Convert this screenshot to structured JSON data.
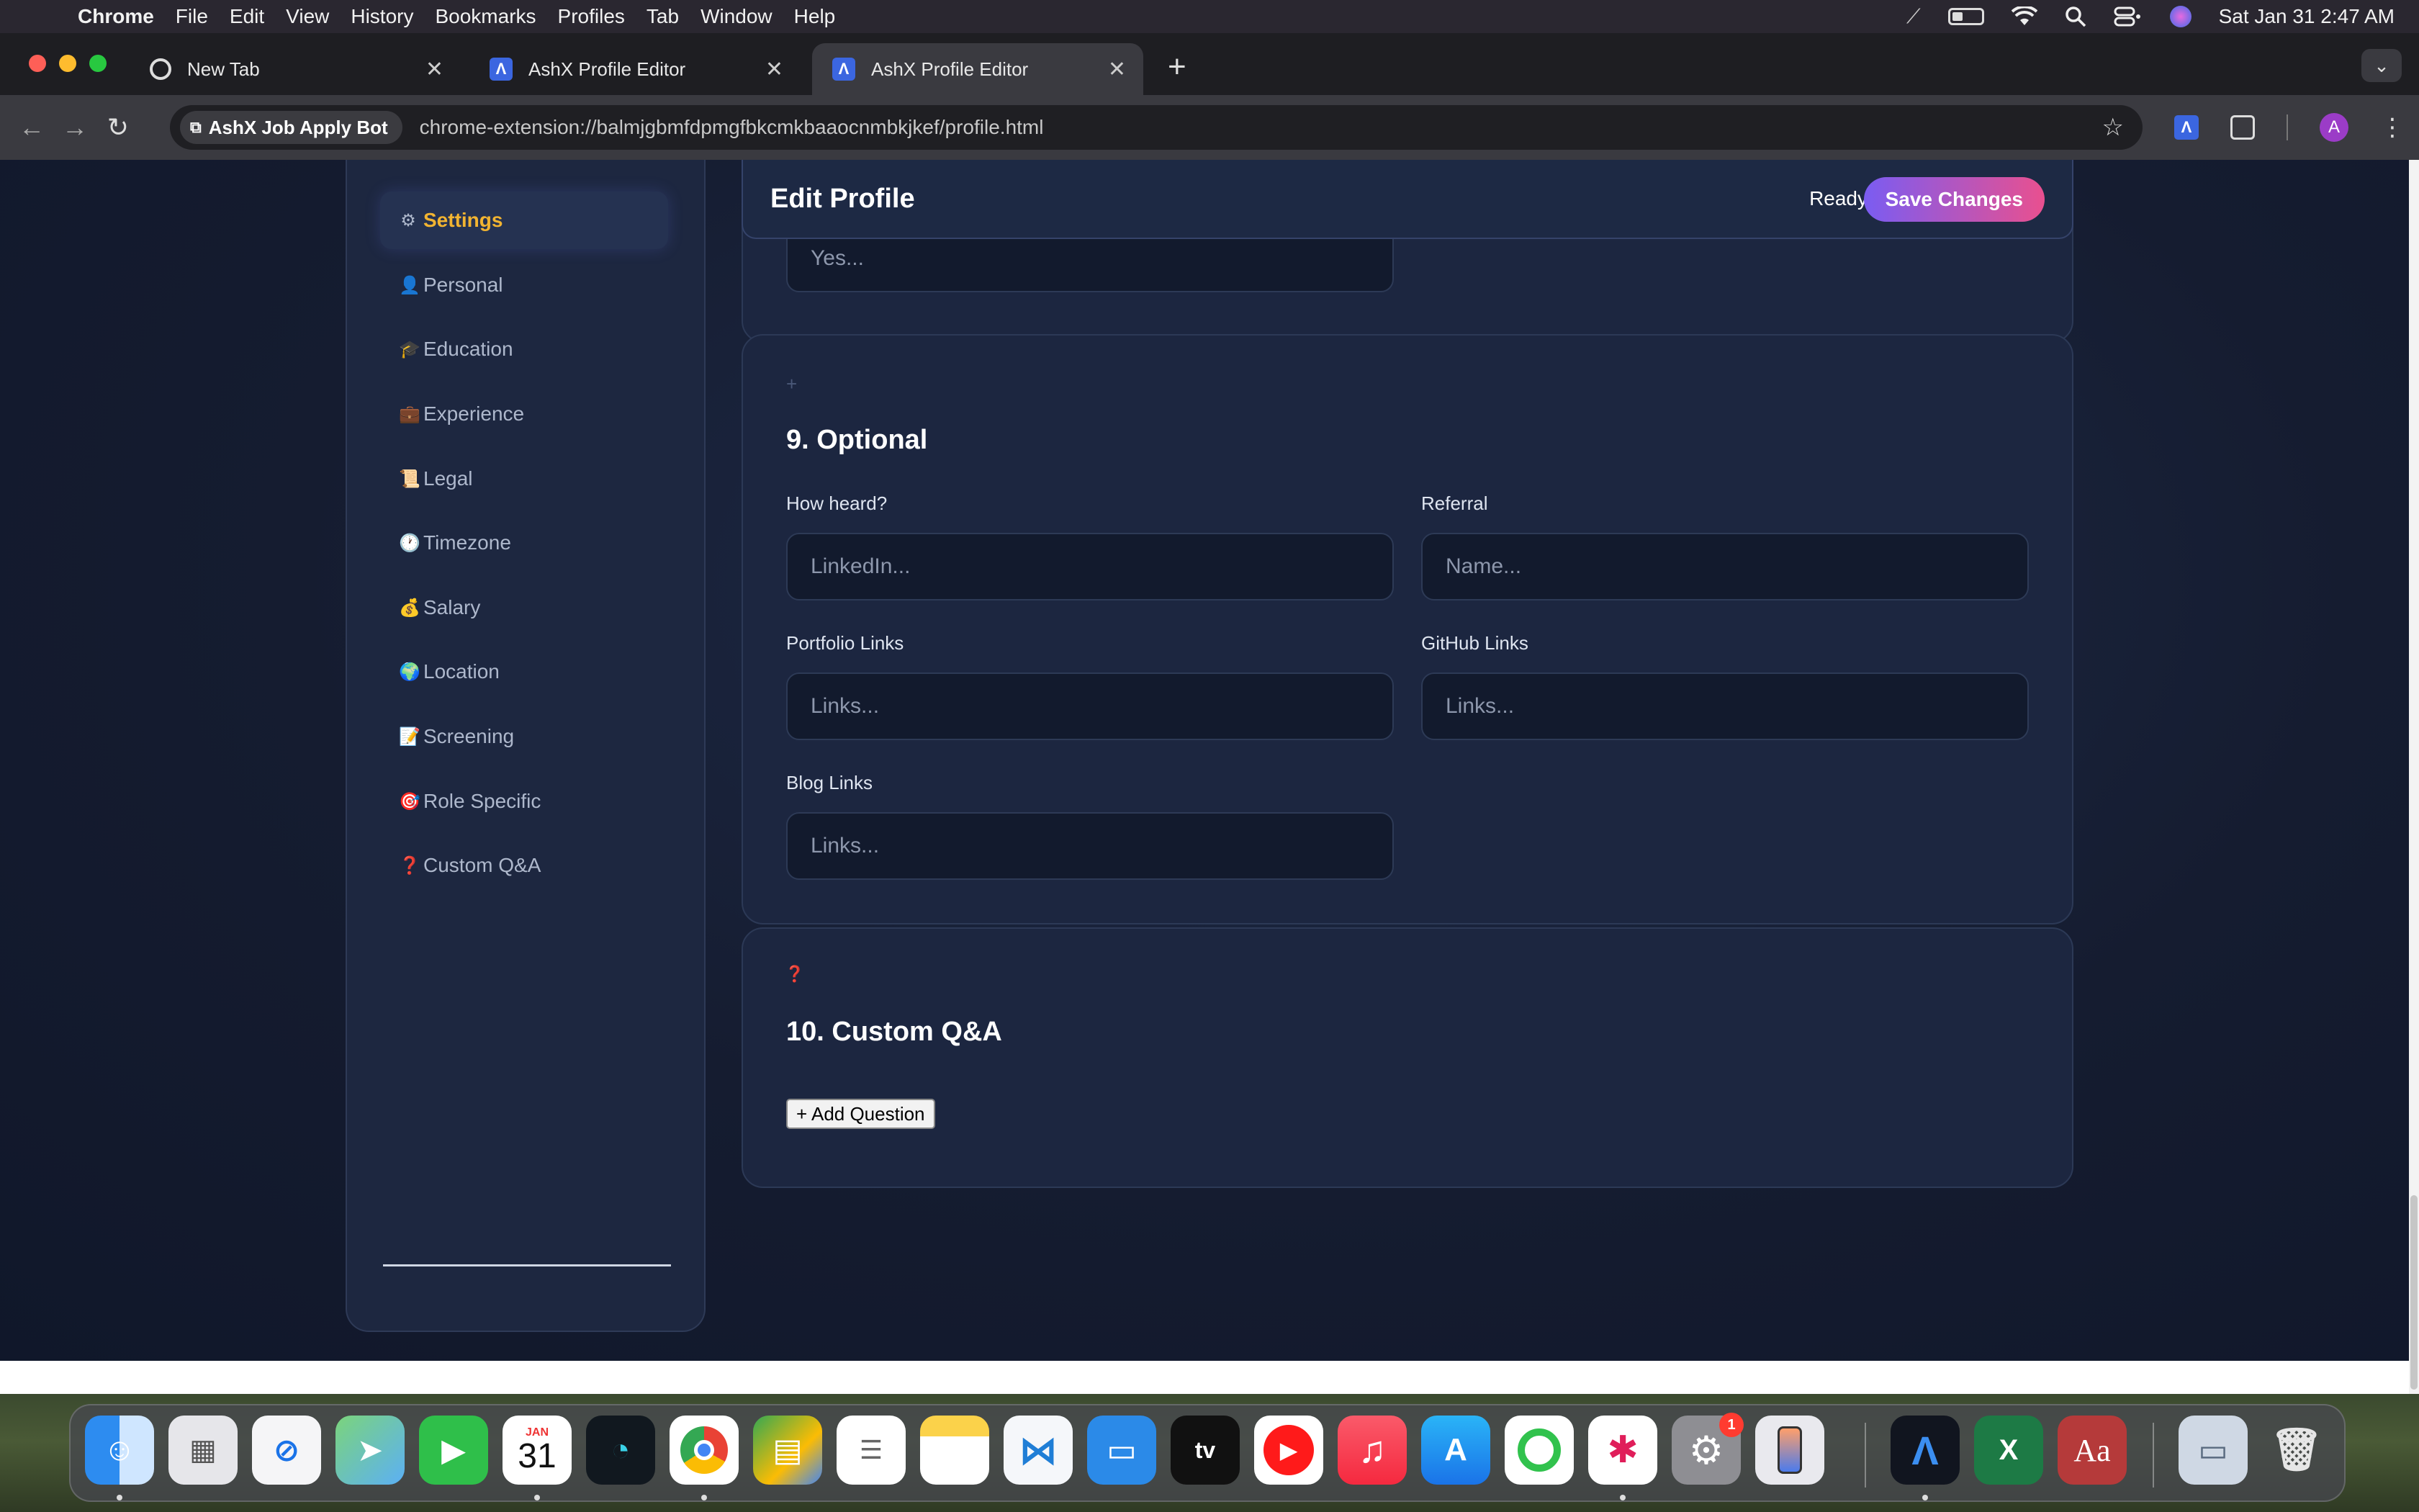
{
  "menubar": {
    "app": "Chrome",
    "items": [
      "File",
      "Edit",
      "View",
      "History",
      "Bookmarks",
      "Profiles",
      "Tab",
      "Window",
      "Help"
    ],
    "clock": "Sat Jan 31  2:47 AM"
  },
  "tabs": [
    {
      "title": "New Tab",
      "icon": "chrome-icon"
    },
    {
      "title": "AshX Profile Editor",
      "icon": "ashx-icon"
    },
    {
      "title": "AshX Profile Editor",
      "icon": "ashx-icon",
      "active": true
    }
  ],
  "addressbar": {
    "chip_label": "AshX Job Apply Bot",
    "url": "chrome-extension://balmjgbmfdpmgfbkcmkbaaocnmbkjkef/profile.html",
    "avatar_letter": "A"
  },
  "sidebar": {
    "items": [
      {
        "icon": "⚙",
        "label": "Settings",
        "active": true
      },
      {
        "icon": "👤",
        "label": "Personal"
      },
      {
        "icon": "🎓",
        "label": "Education"
      },
      {
        "icon": "💼",
        "label": "Experience"
      },
      {
        "icon": "📜",
        "label": "Legal"
      },
      {
        "icon": "🕐",
        "label": "Timezone"
      },
      {
        "icon": "💰",
        "label": "Salary"
      },
      {
        "icon": "🌍",
        "label": "Location"
      },
      {
        "icon": "📝",
        "label": "Screening"
      },
      {
        "icon": "🎯",
        "label": "Role Specific"
      },
      {
        "icon": "❓",
        "label": "Custom Q&A"
      }
    ]
  },
  "header": {
    "title": "Edit Profile",
    "status": "Ready",
    "save_label": "Save Changes"
  },
  "prev_section": {
    "placeholder": "Yes..."
  },
  "optional": {
    "icon": "+",
    "title": "9. Optional",
    "fields": {
      "how_heard": {
        "label": "How heard?",
        "placeholder": "LinkedIn..."
      },
      "referral": {
        "label": "Referral",
        "placeholder": "Name..."
      },
      "portfolio": {
        "label": "Portfolio Links",
        "placeholder": "Links..."
      },
      "github": {
        "label": "GitHub Links",
        "placeholder": "Links..."
      },
      "blog": {
        "label": "Blog Links",
        "placeholder": "Links..."
      }
    }
  },
  "custom_qa": {
    "icon": "❓",
    "title": "10. Custom Q&A",
    "add_label": "+ Add Question"
  },
  "dock": {
    "calendar_month": "JAN",
    "calendar_day": "31",
    "settings_badge": "1",
    "tv_label": "tv",
    "dictionary_label": "Aa"
  },
  "colors": {
    "accent_active": "#f2b431",
    "save_gradient_start": "#7a5cf2",
    "save_gradient_end": "#e9508f",
    "page_bg": "#151c30",
    "card_bg": "#1c2640"
  }
}
